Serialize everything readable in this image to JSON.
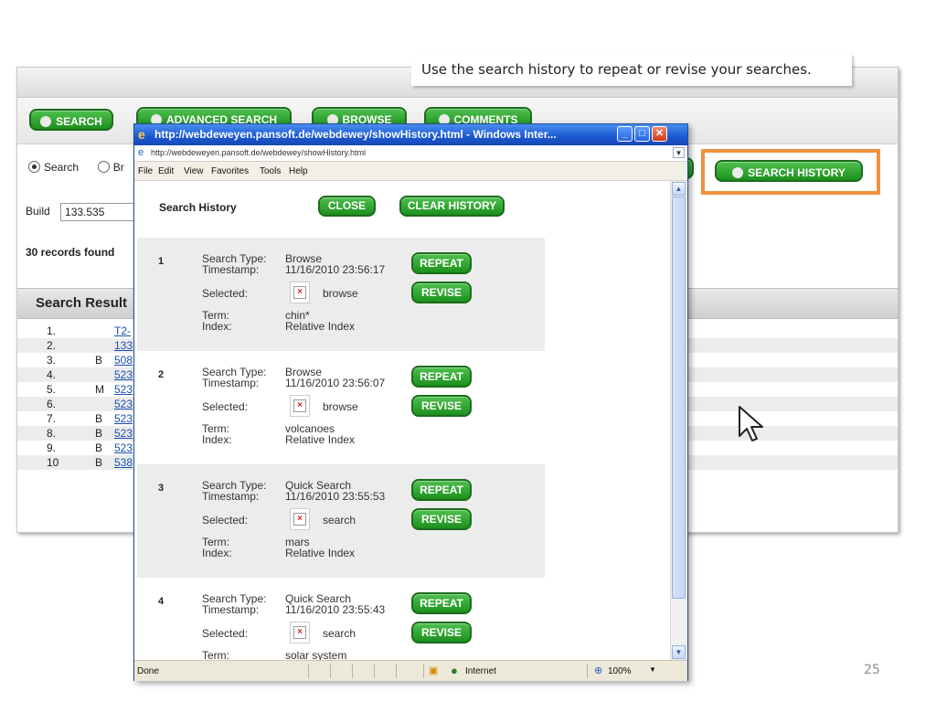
{
  "background_app": {
    "tabs": [
      {
        "label": "SEARCH",
        "icon": "search-icon"
      },
      {
        "label": "ADVANCED SEARCH",
        "icon": "advanced-search-icon"
      },
      {
        "label": "BROWSE",
        "icon": "browse-icon"
      },
      {
        "label": "COMMENTS",
        "icon": "comments-icon"
      }
    ],
    "radio_search_label": "Search",
    "radio_browse_label": "Br",
    "build_label": "Build",
    "build_value": "133.535",
    "records_found": "30 records found",
    "search_history_button": "SEARCH HISTORY",
    "results_title": "Search Result",
    "results": [
      {
        "num": "1.",
        "flag": "",
        "link": "T2-"
      },
      {
        "num": "2.",
        "flag": "",
        "link": "133"
      },
      {
        "num": "3.",
        "flag": "B",
        "link": "508"
      },
      {
        "num": "4.",
        "flag": "",
        "link": "523"
      },
      {
        "num": "5.",
        "flag": "M",
        "link": "523"
      },
      {
        "num": "6.",
        "flag": "",
        "link": "523"
      },
      {
        "num": "7.",
        "flag": "B",
        "link": "523"
      },
      {
        "num": "8.",
        "flag": "B",
        "link": "523"
      },
      {
        "num": "9.",
        "flag": "B",
        "link": "523"
      },
      {
        "num": "10",
        "flag": "B",
        "link": "538"
      }
    ]
  },
  "callout": {
    "text": "Use the search history to repeat or revise your searches."
  },
  "popup": {
    "title": "http://webdeweyen.pansoft.de/webdewey/showHistory.html - Windows Inter...",
    "address": "http://webdeweyen.pansoft.de/webdewey/showHistory.html",
    "menu": [
      "File",
      "Edit",
      "View",
      "Favorites",
      "Tools",
      "Help"
    ],
    "heading": "Search History",
    "close_label": "CLOSE",
    "clear_label": "CLEAR HISTORY",
    "labels": {
      "search_type": "Search Type:",
      "timestamp": "Timestamp:",
      "selected": "Selected:",
      "term": "Term:",
      "index": "Index:"
    },
    "repeat_label": "REPEAT",
    "revise_label": "REVISE",
    "entries": [
      {
        "num": "1",
        "search_type": "Browse",
        "timestamp": "11/16/2010 23:56:17",
        "selected": "browse",
        "term": "chin*",
        "index": "Relative Index"
      },
      {
        "num": "2",
        "search_type": "Browse",
        "timestamp": "11/16/2010 23:56:07",
        "selected": "browse",
        "term": "volcanoes",
        "index": "Relative Index"
      },
      {
        "num": "3",
        "search_type": "Quick Search",
        "timestamp": "11/16/2010 23:55:53",
        "selected": "search",
        "term": "mars",
        "index": "Relative Index"
      },
      {
        "num": "4",
        "search_type": "Quick Search",
        "timestamp": "11/16/2010 23:55:43",
        "selected": "search",
        "term": "solar system",
        "index": ""
      }
    ],
    "status": {
      "done": "Done",
      "zone": "Internet",
      "zoom": "100%"
    }
  },
  "page_number": "25"
}
